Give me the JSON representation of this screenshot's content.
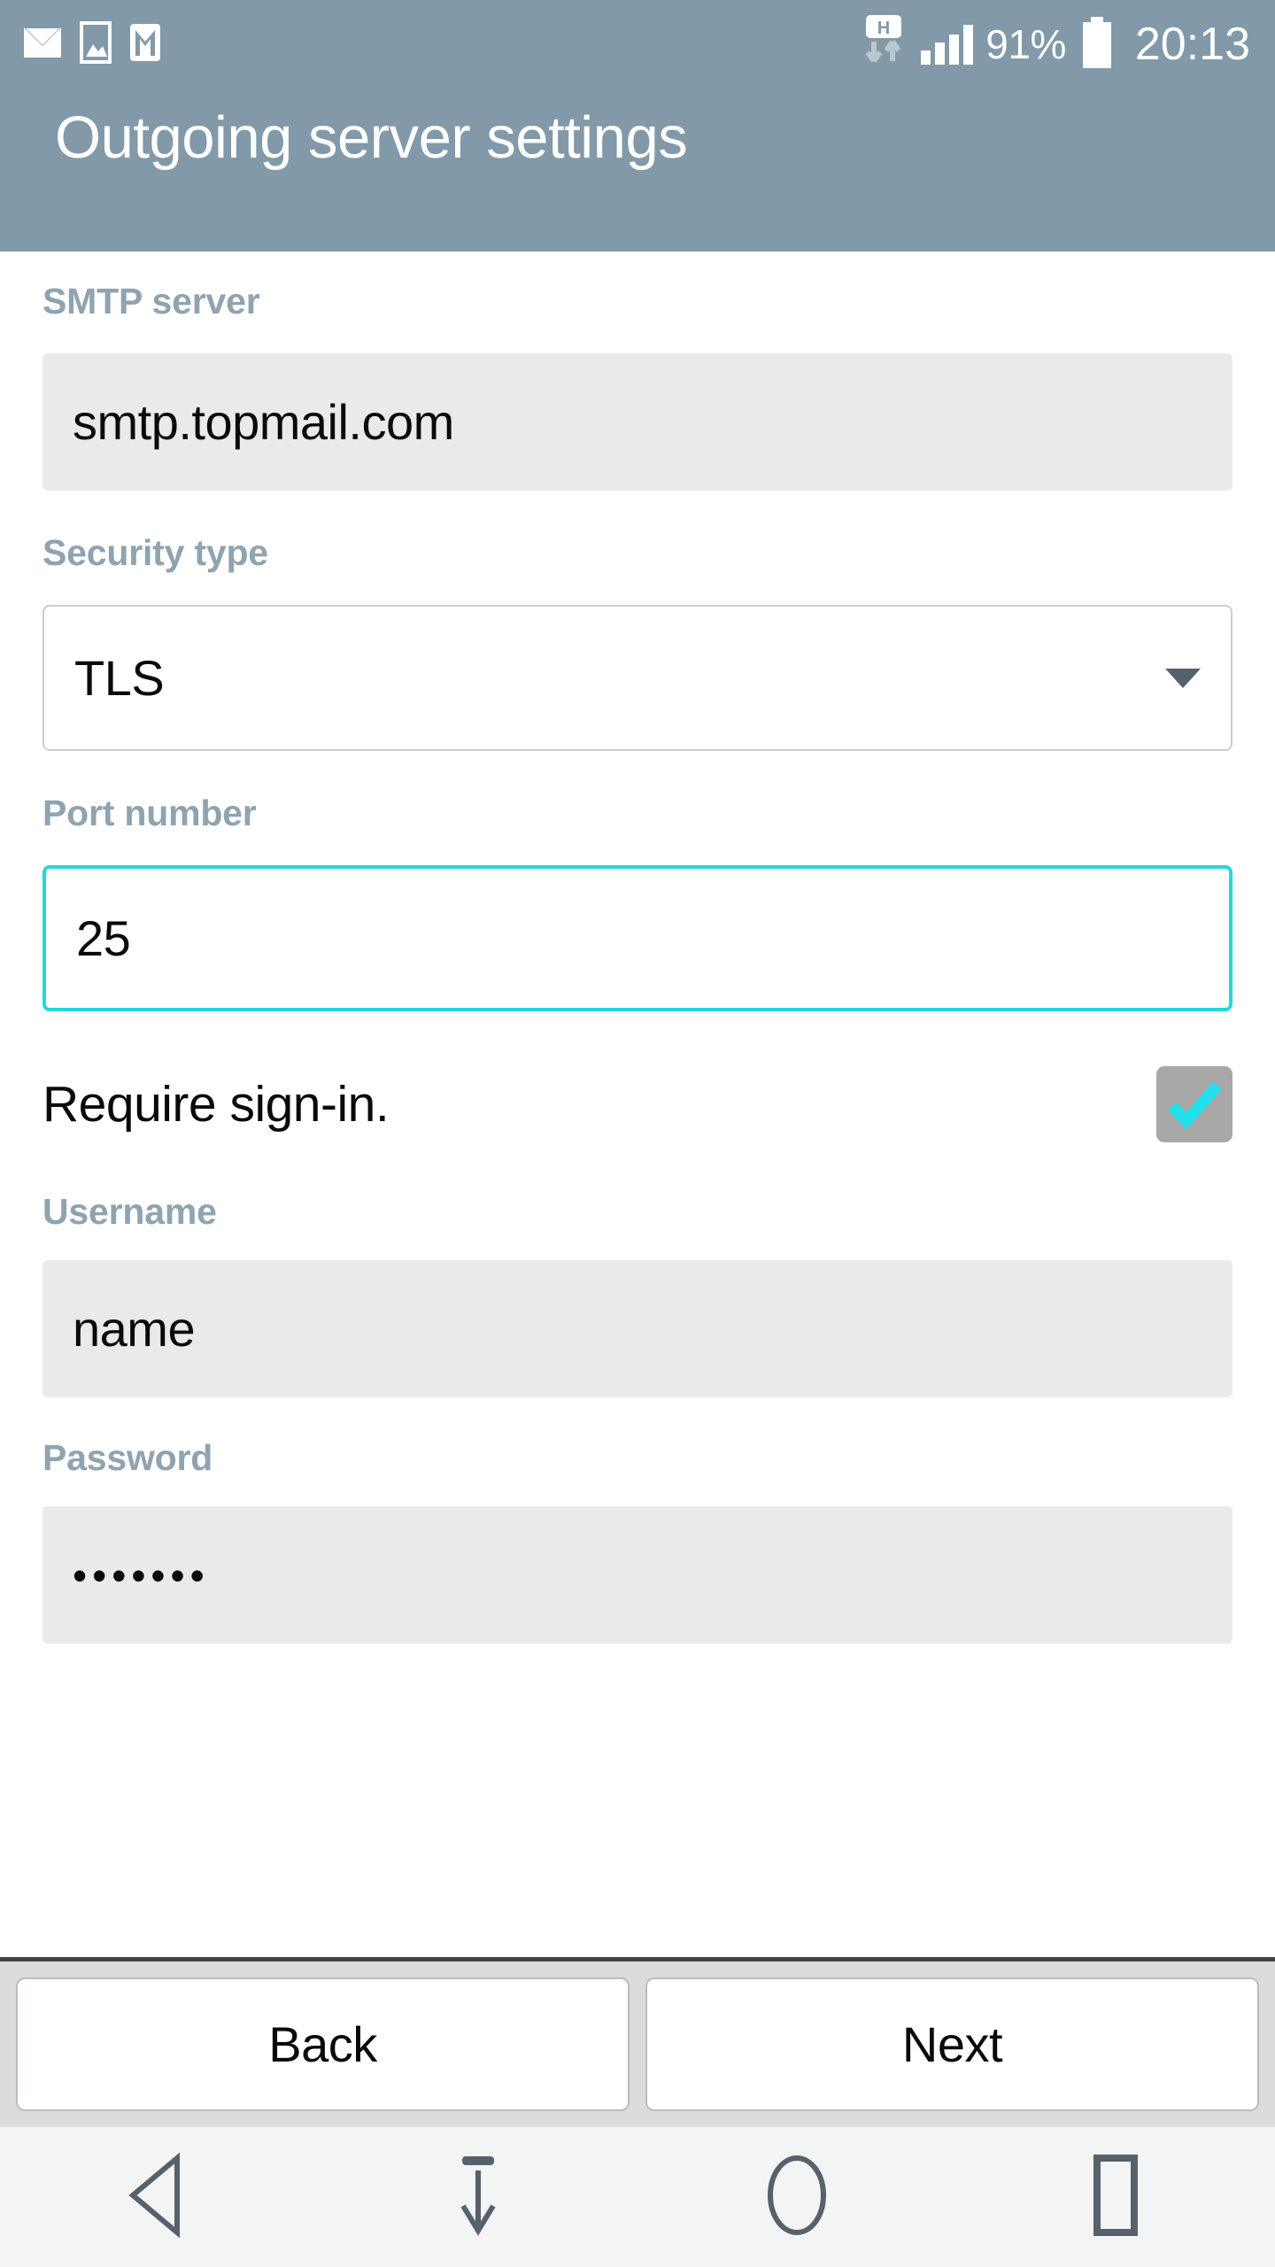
{
  "statusbar": {
    "icons": [
      "envelope-icon",
      "image-icon",
      "gmail-icon"
    ],
    "data_indicator": "H",
    "battery_percent": "91%",
    "clock": "20:13",
    "signal_bars": 4
  },
  "header": {
    "title": "Outgoing server settings",
    "background_color": "#8199a8"
  },
  "form": {
    "smtp_server": {
      "label": "SMTP server",
      "value": "smtp.topmail.com",
      "style": "filled",
      "focused": false
    },
    "security_type": {
      "label": "Security type",
      "value": "TLS",
      "style": "dropdown",
      "focused": false
    },
    "port_number": {
      "label": "Port number",
      "value": "25",
      "style": "outline",
      "focused": true,
      "focus_color": "#22d8de"
    },
    "require_signin": {
      "label": "Require sign-in.",
      "checked": true,
      "box_color": "#a8a8a8",
      "check_color": "#22e0ec"
    },
    "username": {
      "label": "Username",
      "value": "name",
      "style": "filled",
      "focused": false
    },
    "password": {
      "label": "Password",
      "value": "•••••••",
      "style": "filled",
      "focused": false
    }
  },
  "buttons": {
    "back": "Back",
    "next": "Next"
  },
  "navbar": {
    "items": [
      "back-triangle-icon",
      "hide-keyboard-icon",
      "home-circle-icon",
      "recents-square-icon"
    ],
    "icon_color": "#55616b"
  }
}
